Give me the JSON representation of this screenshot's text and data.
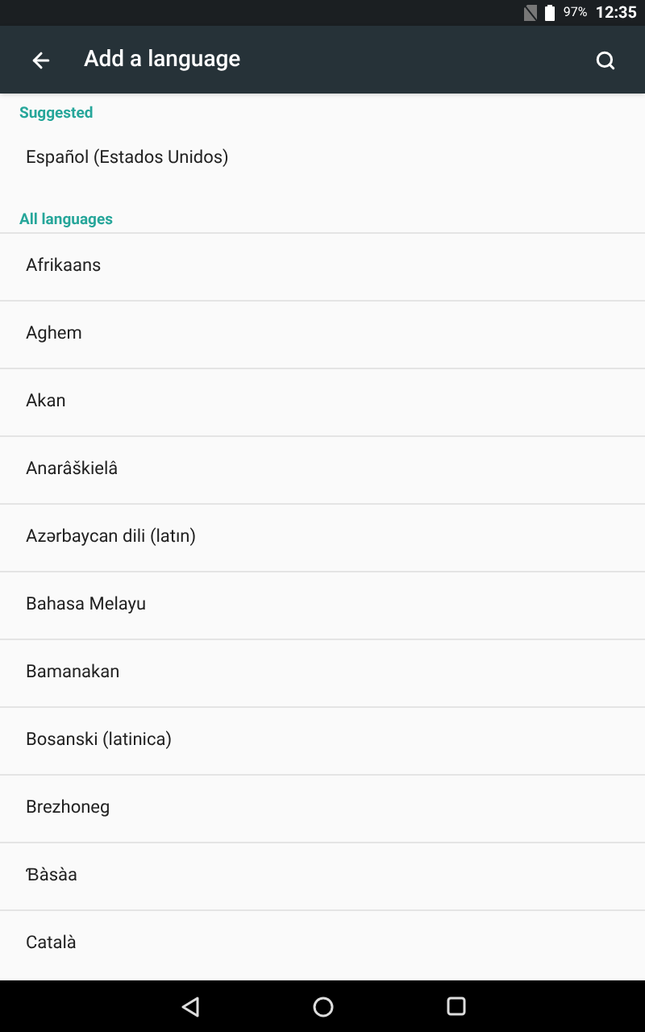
{
  "status_bar": {
    "battery": "97%",
    "time": "12:35"
  },
  "app_bar": {
    "title": "Add a language"
  },
  "sections": [
    {
      "header": "Suggested",
      "items": [
        "Español (Estados Unidos)"
      ]
    },
    {
      "header": "All languages",
      "items": [
        "Afrikaans",
        "Aghem",
        "Akan",
        "Anarâškielâ",
        "Azərbaycan dili (latın)",
        "Bahasa Melayu",
        "Bamanakan",
        "Bosanski (latinica)",
        "Brezhoneg",
        "Ɓàsàa",
        "Català"
      ]
    }
  ]
}
